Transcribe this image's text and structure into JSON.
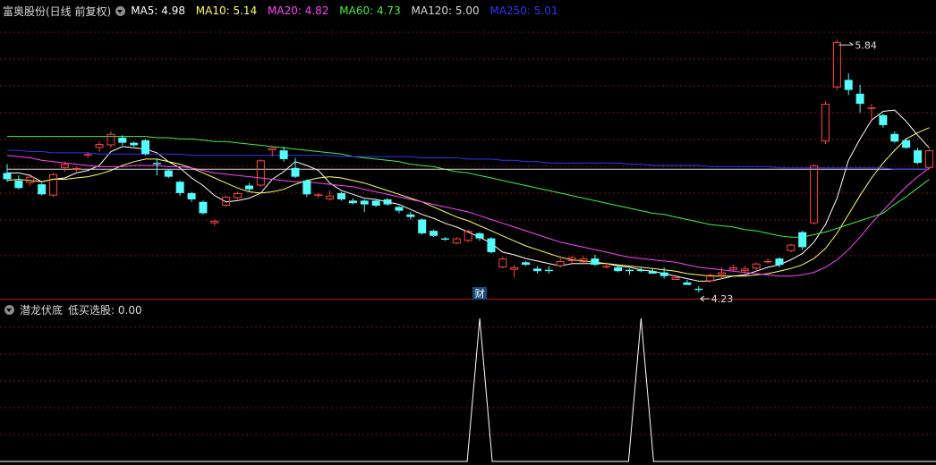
{
  "main_panel": {
    "title": "富奥股份(日线 前复权)",
    "ma_legend": [
      {
        "label": "MA5: 4.98",
        "color": "#ffffff"
      },
      {
        "label": "MA10: 5.14",
        "color": "#ffff66"
      },
      {
        "label": "MA20: 4.82",
        "color": "#ff44ff"
      },
      {
        "label": "MA60: 4.73",
        "color": "#44ee44"
      },
      {
        "label": "MA120: 5.00",
        "color": "#d8d8d8"
      },
      {
        "label": "MA250: 5.01",
        "color": "#3333ff"
      }
    ]
  },
  "sub_panel": {
    "title": "潜龙伏底",
    "indicator_label": "低买选股: 0.00"
  },
  "chart_data": [
    {
      "type": "candlestick",
      "price_range": [
        3.93,
        5.97
      ],
      "annotations": {
        "high_label": "5.84",
        "low_label": "4.23",
        "event_marker": "财"
      },
      "colors": {
        "up": "#ff4444",
        "down": "#54fcfc",
        "doji": "#ffffff"
      },
      "candles": [
        [
          4.78,
          4.85,
          4.71,
          4.73
        ],
        [
          4.72,
          4.76,
          4.65,
          4.66
        ],
        [
          4.7,
          4.77,
          4.68,
          4.75
        ],
        [
          4.69,
          4.7,
          4.6,
          4.61
        ],
        [
          4.6,
          4.78,
          4.59,
          4.77
        ],
        [
          4.82,
          4.87,
          4.79,
          4.85
        ],
        [
          4.81,
          4.83,
          4.79,
          4.82
        ],
        [
          4.92,
          4.94,
          4.9,
          4.93
        ],
        [
          4.98,
          5.03,
          4.95,
          5.01
        ],
        [
          5.0,
          5.11,
          4.98,
          5.09
        ],
        [
          5.06,
          5.08,
          5.0,
          5.02
        ],
        [
          5.02,
          5.03,
          4.99,
          5.0
        ],
        [
          5.04,
          5.05,
          4.92,
          4.93
        ],
        [
          4.86,
          4.89,
          4.76,
          4.85
        ],
        [
          4.8,
          4.81,
          4.74,
          4.75
        ],
        [
          4.71,
          4.72,
          4.6,
          4.62
        ],
        [
          4.62,
          4.63,
          4.55,
          4.57
        ],
        [
          4.55,
          4.56,
          4.45,
          4.46
        ],
        [
          4.38,
          4.41,
          4.36,
          4.4
        ],
        [
          4.52,
          4.6,
          4.51,
          4.59
        ],
        [
          4.58,
          4.63,
          4.57,
          4.62
        ],
        [
          4.68,
          4.7,
          4.63,
          4.65
        ],
        [
          4.68,
          4.89,
          4.67,
          4.88
        ],
        [
          4.96,
          4.99,
          4.91,
          4.98
        ],
        [
          4.96,
          4.99,
          4.87,
          4.89
        ],
        [
          4.82,
          4.9,
          4.74,
          4.75
        ],
        [
          4.72,
          4.73,
          4.59,
          4.61
        ],
        [
          4.6,
          4.62,
          4.58,
          4.61
        ],
        [
          4.57,
          4.64,
          4.56,
          4.6
        ],
        [
          4.62,
          4.63,
          4.56,
          4.57
        ],
        [
          4.56,
          4.58,
          4.53,
          4.54
        ],
        [
          4.56,
          4.57,
          4.47,
          4.53
        ],
        [
          4.56,
          4.57,
          4.51,
          4.52
        ],
        [
          4.57,
          4.58,
          4.52,
          4.53
        ],
        [
          4.51,
          4.52,
          4.46,
          4.48
        ],
        [
          4.45,
          4.47,
          4.41,
          4.43
        ],
        [
          4.41,
          4.42,
          4.29,
          4.3
        ],
        [
          4.32,
          4.33,
          4.27,
          4.28
        ],
        [
          4.26,
          4.27,
          4.24,
          4.25
        ],
        [
          4.22,
          4.27,
          4.21,
          4.26
        ],
        [
          4.24,
          4.33,
          4.23,
          4.32
        ],
        [
          4.3,
          4.31,
          4.24,
          4.26
        ],
        [
          4.26,
          4.27,
          4.14,
          4.15
        ],
        [
          4.03,
          4.11,
          4.02,
          4.1
        ],
        [
          4.01,
          4.05,
          3.95,
          4.03
        ],
        [
          4.07,
          4.08,
          4.04,
          4.05
        ],
        [
          4.02,
          4.04,
          3.98,
          4.0
        ],
        [
          4.01,
          4.04,
          3.98,
          4.0
        ],
        [
          4.04,
          4.1,
          4.03,
          4.08
        ],
        [
          4.08,
          4.12,
          4.05,
          4.11
        ],
        [
          4.07,
          4.12,
          4.06,
          4.1
        ],
        [
          4.1,
          4.13,
          4.04,
          4.05
        ],
        [
          4.03,
          4.07,
          4.02,
          4.04
        ],
        [
          4.03,
          4.05,
          3.99,
          4.0
        ],
        [
          4.01,
          4.02,
          3.97,
          4.0
        ],
        [
          4.01,
          4.03,
          3.99,
          4.0
        ],
        [
          4.0,
          4.02,
          3.98,
          3.98
        ],
        [
          3.99,
          4.03,
          3.94,
          3.96
        ],
        [
          3.93,
          3.97,
          3.93,
          3.95
        ],
        [
          3.91,
          3.93,
          3.89,
          3.89
        ],
        [
          3.86,
          3.88,
          3.83,
          3.85
        ],
        [
          3.92,
          3.98,
          3.91,
          3.97
        ],
        [
          3.97,
          4.03,
          3.94,
          3.99
        ],
        [
          4.01,
          4.05,
          4.0,
          4.03
        ],
        [
          4.0,
          4.04,
          3.98,
          4.02
        ],
        [
          4.02,
          4.07,
          4.0,
          4.06
        ],
        [
          4.07,
          4.1,
          4.06,
          4.08
        ],
        [
          4.1,
          4.11,
          4.03,
          4.05
        ],
        [
          4.16,
          4.22,
          4.15,
          4.21
        ],
        [
          4.31,
          4.32,
          4.17,
          4.19
        ],
        [
          4.38,
          4.85,
          4.37,
          4.84
        ],
        [
          5.03,
          5.35,
          5.01,
          5.33
        ],
        [
          5.46,
          5.84,
          5.44,
          5.82
        ],
        [
          5.52,
          5.57,
          5.4,
          5.44
        ],
        [
          5.41,
          5.48,
          5.26,
          5.33
        ],
        [
          5.29,
          5.33,
          5.21,
          5.3
        ],
        [
          5.24,
          5.25,
          5.14,
          5.16
        ],
        [
          5.09,
          5.11,
          5.02,
          5.03
        ],
        [
          5.04,
          5.06,
          4.97,
          4.98
        ],
        [
          4.96,
          4.98,
          4.85,
          4.86
        ],
        [
          4.82,
          4.97,
          4.81,
          4.96
        ]
      ],
      "ma_lines": [
        {
          "name": "MA5",
          "color": "#ffffff",
          "values": [
            4.78,
            4.78,
            4.76,
            4.71,
            4.73,
            4.74,
            4.78,
            4.8,
            4.84,
            4.95,
            4.99,
            4.98,
            4.97,
            4.94,
            4.87,
            4.82,
            4.74,
            4.68,
            4.6,
            4.55,
            4.56,
            4.58,
            4.62,
            4.73,
            4.79,
            4.87,
            4.84,
            4.8,
            4.7,
            4.64,
            4.61,
            4.58,
            4.57,
            4.55,
            4.53,
            4.49,
            4.45,
            4.42,
            4.38,
            4.35,
            4.31,
            4.27,
            4.22,
            4.15,
            4.13,
            4.1,
            4.08,
            4.06,
            4.04,
            4.06,
            4.06,
            4.06,
            4.06,
            4.04,
            4.03,
            4.01,
            4.0,
            3.98,
            3.96,
            3.94,
            3.92,
            3.92,
            3.94,
            3.96,
            3.97,
            4.0,
            4.03,
            4.05,
            4.09,
            4.14,
            4.23,
            4.37,
            4.58,
            4.88,
            5.05,
            5.2,
            5.27,
            5.28,
            5.19,
            5.08,
            4.98
          ]
        },
        {
          "name": "MA10",
          "color": "#ffff66",
          "values": [
            4.72,
            4.73,
            4.72,
            4.71,
            4.73,
            4.73,
            4.74,
            4.75,
            4.77,
            4.8,
            4.84,
            4.87,
            4.89,
            4.89,
            4.87,
            4.85,
            4.82,
            4.78,
            4.74,
            4.7,
            4.66,
            4.63,
            4.62,
            4.63,
            4.65,
            4.69,
            4.72,
            4.74,
            4.75,
            4.74,
            4.72,
            4.7,
            4.67,
            4.64,
            4.61,
            4.58,
            4.55,
            4.51,
            4.47,
            4.43,
            4.4,
            4.36,
            4.32,
            4.28,
            4.24,
            4.2,
            4.17,
            4.14,
            4.11,
            4.09,
            4.08,
            4.07,
            4.06,
            4.05,
            4.04,
            4.03,
            4.02,
            4.01,
            4.0,
            3.98,
            3.97,
            3.96,
            3.96,
            3.96,
            3.96,
            3.97,
            3.98,
            4.0,
            4.02,
            4.05,
            4.1,
            4.18,
            4.3,
            4.45,
            4.6,
            4.74,
            4.86,
            4.96,
            5.05,
            5.1,
            5.14
          ]
        },
        {
          "name": "MA20",
          "color": "#ff44ff",
          "values": [
            4.92,
            4.91,
            4.9,
            4.88,
            4.87,
            4.86,
            4.85,
            4.84,
            4.83,
            4.83,
            4.83,
            4.84,
            4.84,
            4.84,
            4.83,
            4.83,
            4.82,
            4.8,
            4.78,
            4.77,
            4.76,
            4.75,
            4.74,
            4.73,
            4.72,
            4.71,
            4.71,
            4.7,
            4.69,
            4.68,
            4.67,
            4.65,
            4.63,
            4.61,
            4.59,
            4.57,
            4.55,
            4.53,
            4.51,
            4.49,
            4.47,
            4.44,
            4.41,
            4.38,
            4.35,
            4.32,
            4.29,
            4.26,
            4.23,
            4.21,
            4.19,
            4.17,
            4.15,
            4.13,
            4.11,
            4.1,
            4.09,
            4.08,
            4.07,
            4.05,
            4.03,
            4.02,
            4.01,
            4.0,
            3.99,
            3.98,
            3.97,
            3.96,
            3.96,
            3.97,
            3.99,
            4.03,
            4.09,
            4.17,
            4.27,
            4.38,
            4.48,
            4.58,
            4.67,
            4.75,
            4.82
          ]
        },
        {
          "name": "MA60",
          "color": "#44ee44",
          "values": [
            5.07,
            5.07,
            5.07,
            5.07,
            5.07,
            5.07,
            5.07,
            5.07,
            5.07,
            5.07,
            5.07,
            5.07,
            5.07,
            5.06,
            5.06,
            5.05,
            5.05,
            5.04,
            5.03,
            5.03,
            5.02,
            5.01,
            5.0,
            4.99,
            4.98,
            4.97,
            4.96,
            4.95,
            4.94,
            4.93,
            4.91,
            4.9,
            4.89,
            4.88,
            4.87,
            4.85,
            4.84,
            4.83,
            4.81,
            4.79,
            4.78,
            4.76,
            4.74,
            4.72,
            4.7,
            4.68,
            4.66,
            4.64,
            4.62,
            4.6,
            4.58,
            4.56,
            4.54,
            4.52,
            4.5,
            4.48,
            4.46,
            4.45,
            4.43,
            4.41,
            4.39,
            4.37,
            4.36,
            4.35,
            4.33,
            4.32,
            4.3,
            4.28,
            4.27,
            4.27,
            4.29,
            4.31,
            4.34,
            4.37,
            4.4,
            4.43,
            4.46,
            4.53,
            4.59,
            4.66,
            4.73
          ]
        },
        {
          "name": "MA120",
          "color": "#d8d8d8",
          "values": [
            4.81,
            4.81,
            4.81,
            4.81,
            4.81,
            4.81,
            4.81,
            4.81,
            4.81,
            4.81,
            4.81,
            4.81,
            4.81,
            4.81,
            4.81,
            4.81,
            4.81,
            4.81,
            4.81,
            4.81,
            4.81,
            4.81,
            4.81,
            4.81,
            4.81,
            4.81,
            4.81,
            4.81,
            4.81,
            4.81,
            4.81,
            4.81,
            4.81,
            4.81,
            4.81,
            4.81,
            4.81,
            4.81,
            4.81,
            4.81,
            4.81,
            4.81,
            4.81,
            4.81,
            4.81,
            4.81,
            4.81,
            4.81,
            4.81,
            4.81,
            4.81,
            4.81,
            4.81,
            4.81,
            4.81,
            4.81,
            4.81,
            4.81,
            4.81,
            4.81,
            4.81,
            4.81,
            4.81,
            4.81,
            4.81,
            4.81,
            4.81,
            4.81,
            4.81,
            4.81,
            4.81,
            4.81,
            4.81,
            4.81,
            4.81,
            4.81,
            4.81,
            4.81,
            4.81,
            4.81,
            4.81
          ]
        },
        {
          "name": "MA250",
          "color": "#3333ff",
          "values": [
            4.96,
            4.96,
            4.95,
            4.95,
            4.94,
            4.94,
            4.94,
            4.94,
            4.93,
            4.93,
            4.93,
            4.93,
            4.93,
            4.93,
            4.93,
            4.93,
            4.92,
            4.92,
            4.92,
            4.92,
            4.92,
            4.92,
            4.92,
            4.92,
            4.92,
            4.92,
            4.92,
            4.92,
            4.92,
            4.91,
            4.91,
            4.91,
            4.91,
            4.91,
            4.91,
            4.91,
            4.9,
            4.9,
            4.9,
            4.9,
            4.89,
            4.89,
            4.89,
            4.88,
            4.88,
            4.87,
            4.87,
            4.86,
            4.86,
            4.86,
            4.86,
            4.86,
            4.86,
            4.86,
            4.85,
            4.85,
            4.84,
            4.84,
            4.84,
            4.84,
            4.84,
            4.83,
            4.83,
            4.83,
            4.83,
            4.83,
            4.83,
            4.82,
            4.82,
            4.82,
            4.82,
            4.82,
            4.82,
            4.82,
            4.82,
            4.82,
            4.82,
            4.81,
            4.81,
            4.81,
            4.81
          ]
        }
      ]
    },
    {
      "type": "line",
      "name": "低买选股",
      "y_range": [
        0,
        1
      ],
      "spikes": [
        {
          "candle_index": 41,
          "value": 1
        },
        {
          "candle_index": 55,
          "value": 1
        }
      ]
    }
  ]
}
